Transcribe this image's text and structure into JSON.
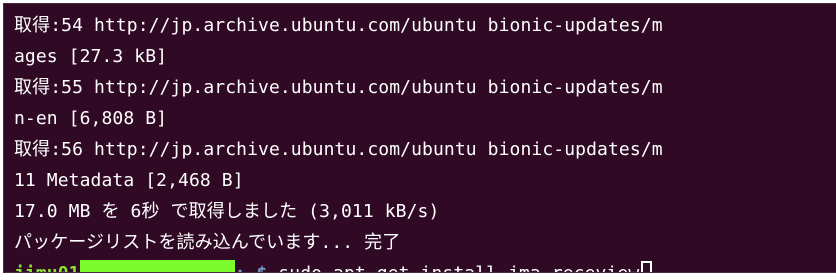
{
  "terminal": {
    "lines": [
      "取得:54 http://jp.archive.ubuntu.com/ubuntu bionic-updates/m",
      "ages [27.3 kB]",
      "取得:55 http://jp.archive.ubuntu.com/ubuntu bionic-updates/m",
      "n-en [6,808 B]",
      "取得:56 http://jp.archive.ubuntu.com/ubuntu bionic-updates/m",
      "11 Metadata [2,468 B]",
      "17.0 MB を 6秒 で取得しました (3,011 kB/s)",
      "パッケージリストを読み込んでいます... 完了"
    ],
    "prompt": {
      "user": "jimu01",
      "path_suffix": ":~$",
      "command": " sudo apt-get install jma-receview"
    }
  },
  "colors": {
    "background": "#300a24",
    "text": "#ffffff",
    "user": "#8ae234",
    "redaction": "#7cfc2c"
  }
}
